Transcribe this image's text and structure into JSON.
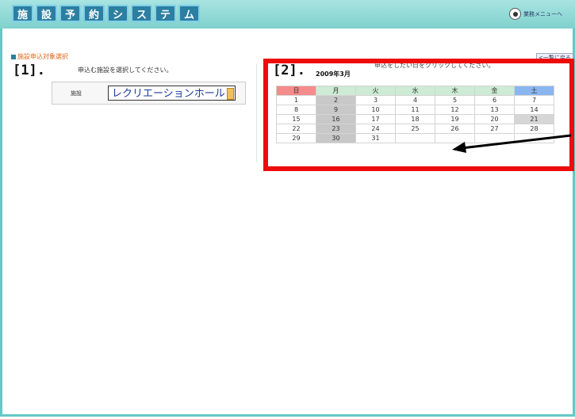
{
  "header": {
    "logo_tiles": [
      "施",
      "設",
      "予",
      "約",
      "シ",
      "ス",
      "テ",
      "ム"
    ],
    "menu_label": "業務メニューへ"
  },
  "breadcrumb": "施設申込対象選択",
  "back_label": "<一覧に戻る",
  "step1": {
    "marker": "[1].",
    "hint": "申込む施設を選択してください。",
    "field_label": "施設",
    "selected_facility": "レクリエーションホール"
  },
  "step2": {
    "marker": "[2].",
    "month_title": "2009年3月",
    "hint": "申込をしたい日をクリックしてください。"
  },
  "calendar": {
    "weekdays": [
      "日",
      "月",
      "火",
      "水",
      "木",
      "金",
      "土"
    ],
    "rows": [
      [
        "1",
        "2",
        "3",
        "4",
        "5",
        "6",
        "7"
      ],
      [
        "8",
        "9",
        "10",
        "11",
        "12",
        "13",
        "14"
      ],
      [
        "15",
        "16",
        "17",
        "18",
        "19",
        "20",
        "21"
      ],
      [
        "22",
        "23",
        "24",
        "25",
        "26",
        "27",
        "28"
      ],
      [
        "29",
        "30",
        "31",
        "",
        "",
        "",
        ""
      ]
    ]
  },
  "colors": {
    "frame_accent": "#63c9c6",
    "highlight_box": "#ee0b0b",
    "sunday_header": "#f58b8b",
    "saturday_header": "#8ab6f0"
  }
}
